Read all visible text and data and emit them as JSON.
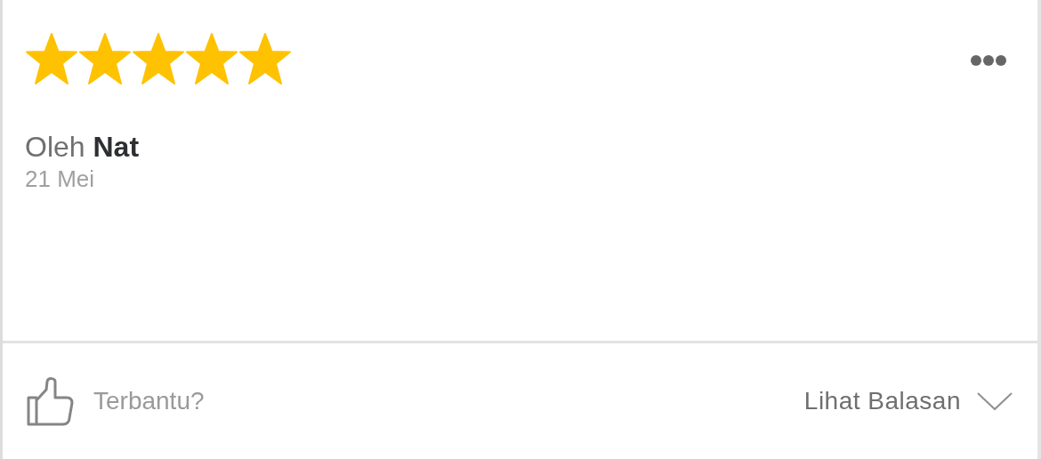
{
  "review": {
    "stars": 5,
    "author": "Oleh **Nat**",
    "date": "21 Mei"
  },
  "footer": {
    "helpful_label": "Terbantu?",
    "replies_label": "Lihat Balasan"
  }
}
